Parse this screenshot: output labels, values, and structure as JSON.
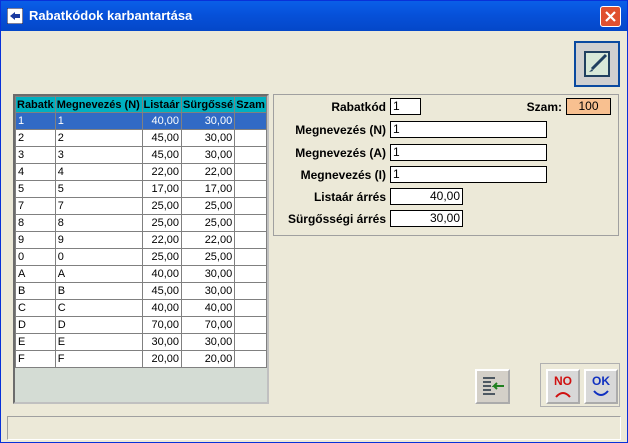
{
  "window": {
    "title": "Rabatkódok karbantartása"
  },
  "grid": {
    "columns": [
      "Rabatk",
      "Megnevezés (N)",
      "Listaár",
      "Sürgőssé",
      "Szam"
    ],
    "rows": [
      [
        "1",
        "1",
        "40,00",
        "30,00",
        ""
      ],
      [
        "2",
        "2",
        "45,00",
        "30,00",
        ""
      ],
      [
        "3",
        "3",
        "45,00",
        "30,00",
        ""
      ],
      [
        "4",
        "4",
        "22,00",
        "22,00",
        ""
      ],
      [
        "5",
        "5",
        "17,00",
        "17,00",
        ""
      ],
      [
        "7",
        "7",
        "25,00",
        "25,00",
        ""
      ],
      [
        "8",
        "8",
        "25,00",
        "25,00",
        ""
      ],
      [
        "9",
        "9",
        "22,00",
        "22,00",
        ""
      ],
      [
        "0",
        "0",
        "25,00",
        "25,00",
        ""
      ],
      [
        "A",
        "A",
        "40,00",
        "30,00",
        ""
      ],
      [
        "B",
        "B",
        "45,00",
        "30,00",
        ""
      ],
      [
        "C",
        "C",
        "40,00",
        "40,00",
        ""
      ],
      [
        "D",
        "D",
        "70,00",
        "70,00",
        ""
      ],
      [
        "E",
        "E",
        "30,00",
        "30,00",
        ""
      ],
      [
        "F",
        "F",
        "20,00",
        "20,00",
        ""
      ]
    ],
    "selected_index": 0
  },
  "form": {
    "rabatkod_label": "Rabatkód",
    "rabatkod_value": "1",
    "szam_label": "Szam:",
    "szam_value": "100",
    "megnev_n_label": "Megnevezés (N)",
    "megnev_n_value": "1",
    "megnev_a_label": "Megnevezés (A)",
    "megnev_a_value": "1",
    "megnev_i_label": "Megnevezés (I)",
    "megnev_i_value": "1",
    "listaar_label": "Listaár árrés",
    "listaar_value": "40,00",
    "surgossegi_label": "Sürgősségi árrés",
    "surgossegi_value": "30,00"
  },
  "buttons": {
    "no_label": "NO",
    "ok_label": "OK"
  },
  "colors": {
    "szam_bg": "#f8c090",
    "selected_row": "#316ac5",
    "header": "#00b0c0"
  }
}
